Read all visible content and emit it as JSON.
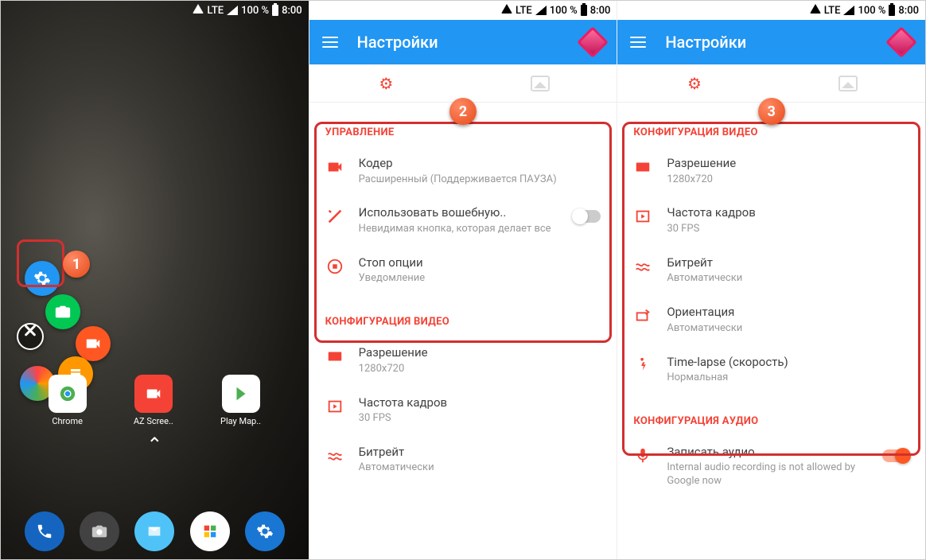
{
  "statusbar": {
    "net": "LTE",
    "battery": "100 %",
    "time": "8:00"
  },
  "appbar": {
    "title": "Настройки"
  },
  "home": {
    "apps": [
      "Chrome",
      "AZ Scree..",
      "Play Map.."
    ]
  },
  "panel2": {
    "section1": "УПРАВЛЕНИЕ",
    "items1": [
      {
        "title": "Кодер",
        "sub": "Расширенный (Поддерживается ПАУЗА)"
      },
      {
        "title": "Использовать вошебную..",
        "sub": "Невидимая кнопка, которая делает все"
      },
      {
        "title": "Стоп опции",
        "sub": "Уведомление"
      }
    ],
    "section2": "КОНФИГУРАЦИЯ ВИДЕО",
    "items2": [
      {
        "title": "Разрешение",
        "sub": "1280x720"
      },
      {
        "title": "Частота кадров",
        "sub": "30 FPS"
      },
      {
        "title": "Битрейт",
        "sub": "Автоматически"
      }
    ]
  },
  "panel3": {
    "section1": "КОНФИГУРАЦИЯ ВИДЕО",
    "items1": [
      {
        "title": "Разрешение",
        "sub": "1280x720"
      },
      {
        "title": "Частота кадров",
        "sub": "30 FPS"
      },
      {
        "title": "Битрейт",
        "sub": "Автоматически"
      },
      {
        "title": "Ориентация",
        "sub": "Автоматически"
      },
      {
        "title": "Time-lapse (скорость)",
        "sub": "Нормальная"
      }
    ],
    "section2": "КОНФИГУРАЦИЯ АУДИО",
    "items2": [
      {
        "title": "Записать аудио",
        "sub": "Internal audio recording is not allowed by Google now"
      }
    ]
  },
  "badges": [
    "1",
    "2",
    "3"
  ]
}
